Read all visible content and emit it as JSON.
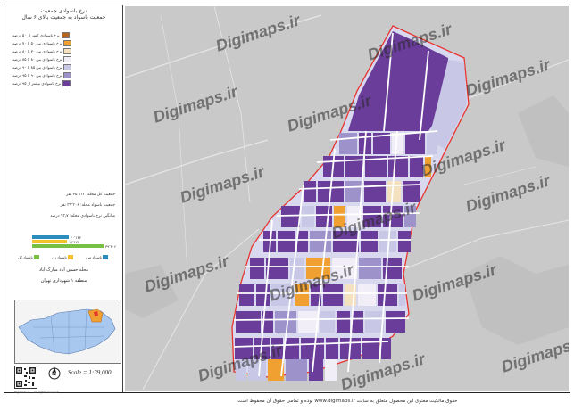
{
  "legend": {
    "title_line1": "نرخ باسوادی جمعیت",
    "title_line2": "جمعیت باسواد به جمعیت بالای ۶ سال",
    "items": [
      {
        "label": "نرخ باسوادی کمتر از ۵۰ درصد",
        "color": "#b5651d"
      },
      {
        "label": "نرخ باسوادی بین ۵۰ تا ۷۰ درصد",
        "color": "#f0a030"
      },
      {
        "label": "نرخ باسوادی بین ۷۰ تا ۸۰ درصد",
        "color": "#f3e1bf"
      },
      {
        "label": "نرخ باسوادی بین ۸۰ تا ۸۵ درصد",
        "color": "#f1eef7"
      },
      {
        "label": "نرخ باسوادی بین ۸۵ تا ۹۰ درصد",
        "color": "#c8c8e6"
      },
      {
        "label": "نرخ باسوادی بین ۹۰ تا ۹۵ درصد",
        "color": "#9d92c9"
      },
      {
        "label": "نرخ باسوادی بیشتر از ۹۵ درصد",
        "color": "#6a3d9a"
      }
    ]
  },
  "info": {
    "population": "جمعیت کل محله: ۴۵٬۱۱۳ نفر",
    "literate": "جمعیت باسواد محله: ۳۹٬۳۰۶ نفر",
    "average": "میانگین نرخ باسوادی محله: ۹۳٫۷ درصد"
  },
  "bars": [
    {
      "value": 20134,
      "label": "۲۰٬۱۳۴",
      "color": "#2b8cbe"
    },
    {
      "value": 19172,
      "label": "۱۹٬۱۷۲",
      "color": "#f2c12e"
    },
    {
      "value": 39306,
      "label": "۳۹٬۳۰۶",
      "color": "#78c043"
    }
  ],
  "bar_keys": [
    {
      "label": "باسواد مرد",
      "color": "#2b8cbe"
    },
    {
      "label": "باسواد زن",
      "color": "#f2c12e"
    },
    {
      "label": "باسواد کل",
      "color": "#78c043"
    }
  ],
  "district": {
    "line1": "محله حسین آباد مبارک آباد",
    "line2": "منطقه ۱ شهرداری تهران"
  },
  "scale": "Scale = 1:39,000",
  "north": "N",
  "copyright": "Digimaps.ir — All rights reserved",
  "watermark": "Digimaps.ir",
  "footer": "حقوق مالکیت معنوی این محصول متعلق به سایت www.digimaps.ir بوده و تمامی حقوق آن محفوظ است.",
  "colors": {
    "boundary": "#e8342f",
    "dominant": "#6a3d9a",
    "background_map": "#c9c9c9"
  }
}
